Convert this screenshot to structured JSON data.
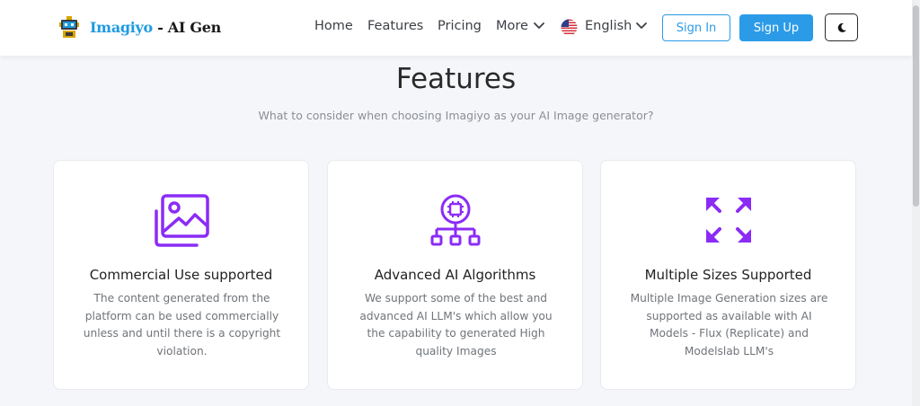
{
  "header": {
    "brand_name": "Imagiyo",
    "brand_suffix": " - AI Gen",
    "nav": {
      "home": "Home",
      "features": "Features",
      "pricing": "Pricing",
      "more": "More",
      "language": "English"
    },
    "sign_in": "Sign In",
    "sign_up": "Sign Up",
    "theme_icon": "moon-icon"
  },
  "features": {
    "title": "Features",
    "subtitle": "What to consider when choosing Imagiyo as your AI Image generator?",
    "cards": [
      {
        "icon": "images-icon",
        "title": "Commercial Use supported",
        "description": "The content generated from the platform can be used commercially unless and until there is a copyright violation."
      },
      {
        "icon": "cpu-network-icon",
        "title": "Advanced AI Algorithms",
        "description": "We support some of the best and advanced AI LLM's which allow you the capability to generated High quality Images"
      },
      {
        "icon": "expand-arrows-icon",
        "title": "Multiple Sizes Supported",
        "description": "Multiple Image Generation sizes are supported as available with AI Models - Flux (Replicate) and Modelslab LLM's"
      }
    ]
  },
  "colors": {
    "accent": "#2b9be8",
    "icon_purple": "#8b2cf5",
    "background": "#f5f6fa"
  }
}
